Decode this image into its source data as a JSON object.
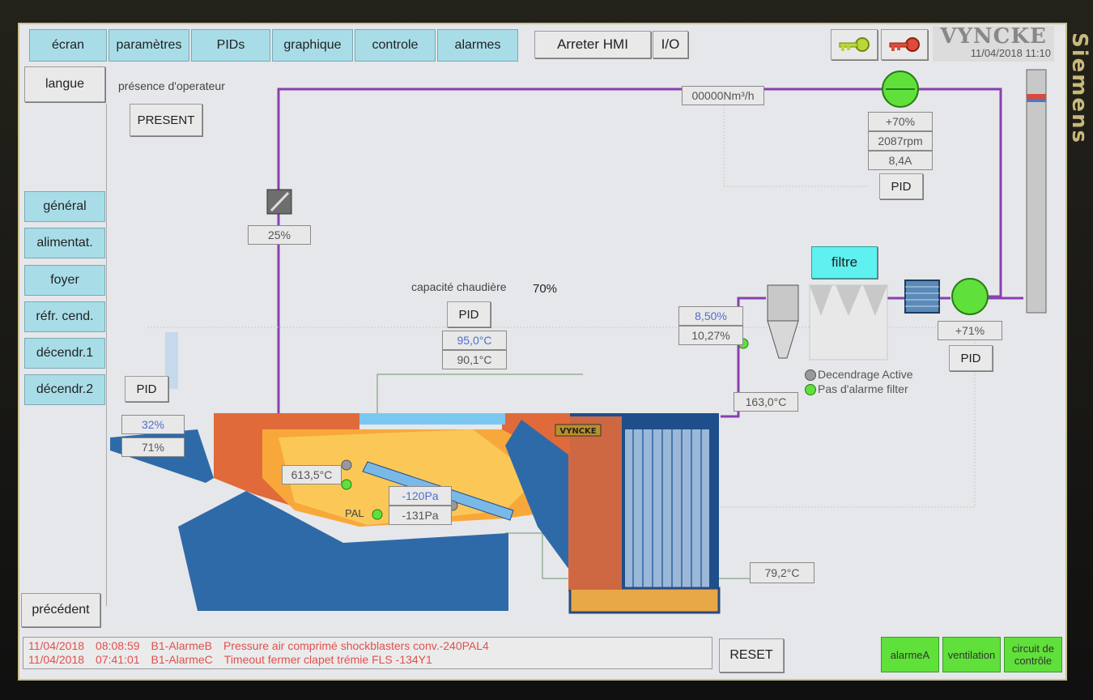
{
  "device": {
    "bezel_text": "Siemens"
  },
  "tabs": [
    "écran",
    "paramètres",
    "PIDs",
    "graphique",
    "controle",
    "alarmes"
  ],
  "top": {
    "arreter_label": "Arreter HMI",
    "io_label": "I/O",
    "logo": "VYNCKE",
    "datetime": "11/04/2018 11:10"
  },
  "sidebar": {
    "langue": "langue",
    "items": [
      "général",
      "alimentat.",
      "foyer",
      "réfr. cend.",
      "décendr.1",
      "décendr.2"
    ],
    "precedent": "précédent"
  },
  "operator": {
    "label": "présence d'operateur",
    "button": "PRESENT"
  },
  "fan_top": {
    "flow": "00000Nm³/h",
    "speed": "+70%",
    "rpm": "2087rpm",
    "current": "8,4A",
    "pid": "PID"
  },
  "damper": {
    "value": "25%"
  },
  "boiler": {
    "capacity_label": "capacité chaudière",
    "capacity_value": "70%",
    "pid": "PID",
    "setpoint_temp": "95,0°C",
    "actual_temp": "90,1°C"
  },
  "feeder": {
    "pid": "PID",
    "value1": "32%",
    "value2": "71%"
  },
  "furnace": {
    "temp": "613,5°C",
    "pal_label": "PAL",
    "pressure_set": "-120Pa",
    "pressure_actual": "-131Pa",
    "outlet_temp": "79,2°C",
    "brand": "VYNCKE"
  },
  "flue": {
    "o2_set": "8,50%",
    "o2_actual": "10,27%",
    "temp": "163,0°C",
    "filter_label": "filtre",
    "status1": "Decendrage Active",
    "status2": "Pas d'alarme filter",
    "fan_speed": "+71%",
    "pid": "PID"
  },
  "alarms": [
    {
      "date": "11/04/2018",
      "time": "08:08:59",
      "code": "B1-AlarmeB",
      "message": "Pressure air comprimé shockblasters conv.-240PAL4"
    },
    {
      "date": "11/04/2018",
      "time": "07:41:01",
      "code": "B1-AlarmeC",
      "message": "Timeout fermer clapet trémie FLS -134Y1"
    }
  ],
  "bottom": {
    "reset": "RESET",
    "alarmeA": "alarmeA",
    "ventilation": "ventilation",
    "circuit": "circuit de contrôle"
  },
  "colors": {
    "tab": "#a8dde8",
    "pipe": "#8a3fb0",
    "green": "#5fe03a",
    "alarm_text": "#e05050",
    "filter_box": "#5ff0f0"
  },
  "icons": [
    "key-green-icon",
    "key-red-icon",
    "fan-icon",
    "damper-icon",
    "cyclone-icon",
    "heat-exchanger-icon",
    "chimney-icon"
  ]
}
